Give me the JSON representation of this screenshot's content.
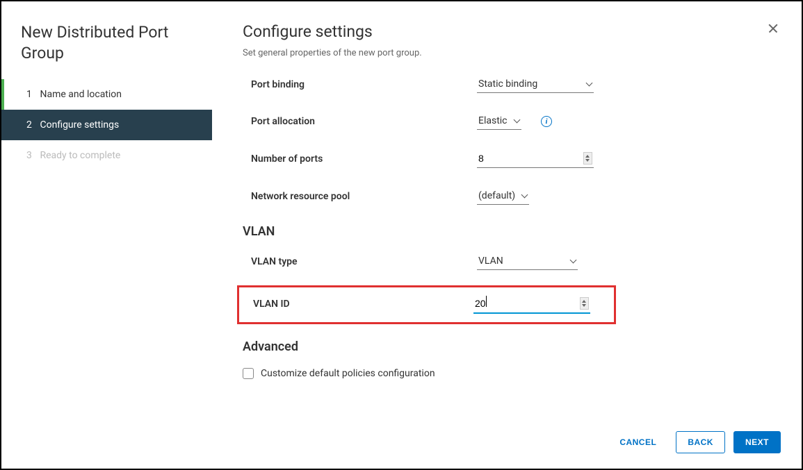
{
  "wizard_title": "New Distributed Port Group",
  "steps": [
    {
      "num": "1",
      "label": "Name and location",
      "state": "completed"
    },
    {
      "num": "2",
      "label": "Configure settings",
      "state": "active"
    },
    {
      "num": "3",
      "label": "Ready to complete",
      "state": "disabled"
    }
  ],
  "content": {
    "title": "Configure settings",
    "subtitle": "Set general properties of the new port group.",
    "port_binding": {
      "label": "Port binding",
      "value": "Static binding"
    },
    "port_allocation": {
      "label": "Port allocation",
      "value": "Elastic"
    },
    "number_of_ports": {
      "label": "Number of ports",
      "value": "8"
    },
    "network_resource_pool": {
      "label": "Network resource pool",
      "value": "(default)"
    },
    "vlan_section": "VLAN",
    "vlan_type": {
      "label": "VLAN type",
      "value": "VLAN"
    },
    "vlan_id": {
      "label": "VLAN ID",
      "value": "20"
    },
    "advanced_section": "Advanced",
    "customize_checkbox": {
      "label": "Customize default policies configuration",
      "checked": false
    }
  },
  "footer": {
    "cancel": "CANCEL",
    "back": "BACK",
    "next": "NEXT"
  }
}
